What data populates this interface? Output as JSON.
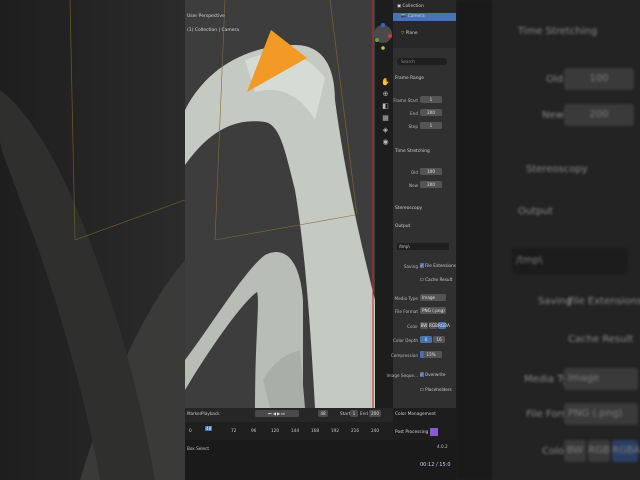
{
  "viewport": {
    "mode_label": "User Perspective",
    "collection_label": "(1) Collection | Camera"
  },
  "outliner": {
    "items": [
      {
        "label": "Collection"
      },
      {
        "label": "Camera"
      },
      {
        "label": "Plane"
      }
    ]
  },
  "properties": {
    "search_placeholder": "Search",
    "frame_range": {
      "header": "Frame Range",
      "frame_start_label": "Frame Start",
      "frame_start": "1",
      "end_label": "End",
      "end": "200",
      "step_label": "Step",
      "step": "1"
    },
    "time_stretching": {
      "header": "Time Stretching",
      "old_label": "Old",
      "old": "100",
      "new_label": "New",
      "new": "200"
    },
    "stereoscopy_header": "Stereoscopy",
    "output": {
      "header": "Output",
      "path": "/tmp\\",
      "saving_label": "Saving",
      "file_extensions": "File Extensions",
      "cache_result": "Cache Result",
      "media_type_label": "Media Type",
      "media_type": "Image",
      "file_format_label": "File Format",
      "file_format": "PNG (.png)",
      "color_label": "Color",
      "color_options": [
        "BW",
        "RGB",
        "RGBA"
      ],
      "color_depth_label": "Color Depth",
      "color_depth_options": [
        "8",
        "16"
      ],
      "compression_label": "Compression",
      "compression": "15%",
      "image_sequence_label": "Image Seque...",
      "overwrite": "Overwrite",
      "placeholders": "Placeholders"
    },
    "color_management_header": "Color Management",
    "post_processing_header": "Post Processing"
  },
  "timeline": {
    "marker_label": "Marker",
    "playback_label": "Playback",
    "current_frame": "48",
    "start_label": "Start",
    "start": "1",
    "end_label": "End",
    "end": "200",
    "ruler": [
      "0",
      "48",
      "72",
      "96",
      "120",
      "144",
      "168",
      "192",
      "216",
      "240"
    ]
  },
  "status": {
    "left": "Box Select",
    "right": "4.0.2",
    "time": "00:12 / 15:0"
  },
  "background_right": {
    "time_stretching": "Time Stretching",
    "old_label": "Old",
    "old": "100",
    "new_label": "New",
    "new": "200",
    "stereoscopy": "Stereoscopy",
    "output": "Output",
    "path": "/tmp\\",
    "saving": "Saving",
    "file_extensions": "File Extensions",
    "cache_result": "Cache Result",
    "media_type_label": "Media Type",
    "media_type": "Image",
    "file_format_label": "File Format",
    "file_format": "PNG (.png)",
    "color_label": "Color",
    "color_options": [
      "BW",
      "RGB",
      "RGBA"
    ]
  },
  "colors": {
    "camera_orange": "#f29a25",
    "selected_blue": "#4772b3",
    "timeline_red": "#c2262d"
  }
}
